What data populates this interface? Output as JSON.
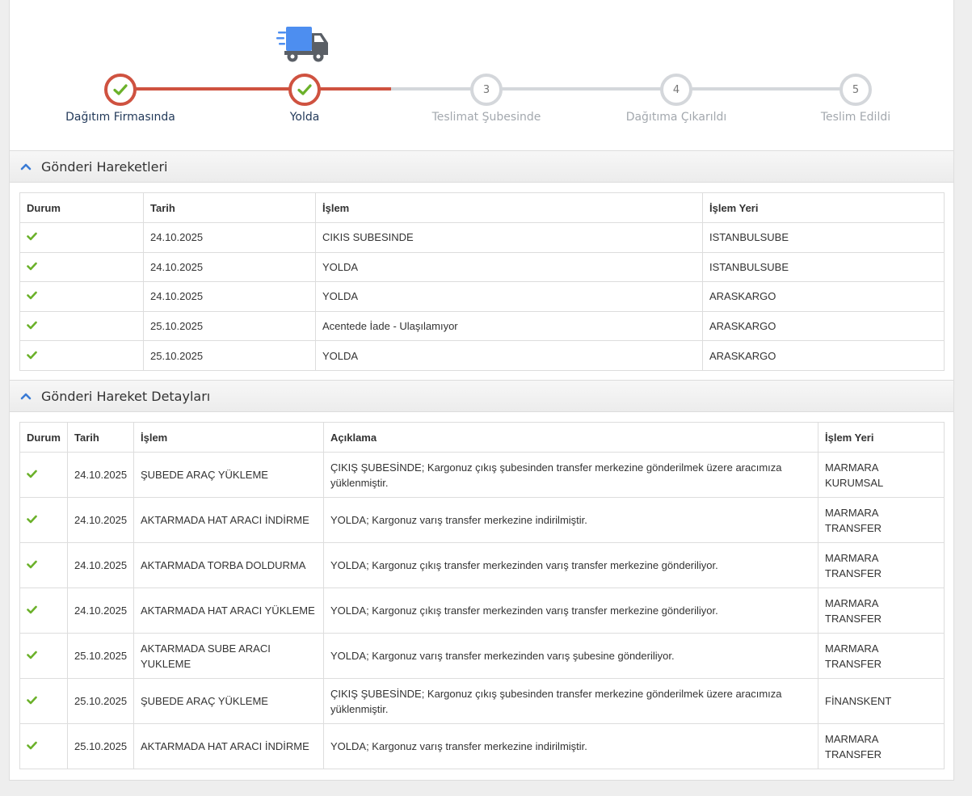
{
  "tracker": {
    "truck_icon": "truck-icon",
    "steps": [
      {
        "number": "1",
        "label": "Dağıtım Firmasında",
        "status": "done"
      },
      {
        "number": "2",
        "label": "Yolda",
        "status": "done"
      },
      {
        "number": "3",
        "label": "Teslimat Şubesinde",
        "status": "pending"
      },
      {
        "number": "4",
        "label": "Dağıtıma Çıkarıldı",
        "status": "pending"
      },
      {
        "number": "5",
        "label": "Teslim Edildi",
        "status": "pending"
      }
    ],
    "colors": {
      "done": "#cf5240",
      "pending": "#d4d7db",
      "check": "#6bb12a"
    }
  },
  "movements": {
    "title": "Gönderi Hareketleri",
    "headers": [
      "Durum",
      "Tarih",
      "İşlem",
      "İşlem Yeri"
    ],
    "rows": [
      {
        "status_icon": "check-icon",
        "date": "24.10.2025",
        "action": "CIKIS SUBESINDE",
        "place": "ISTANBULSUBE"
      },
      {
        "status_icon": "check-icon",
        "date": "24.10.2025",
        "action": "YOLDA",
        "place": "ISTANBULSUBE"
      },
      {
        "status_icon": "check-icon",
        "date": "24.10.2025",
        "action": "YOLDA",
        "place": "ARASKARGO"
      },
      {
        "status_icon": "check-icon",
        "date": "25.10.2025",
        "action": "Acentede İade - Ulaşılamıyor",
        "place": "ARASKARGO"
      },
      {
        "status_icon": "check-icon",
        "date": "25.10.2025",
        "action": "YOLDA",
        "place": "ARASKARGO"
      }
    ]
  },
  "details": {
    "title": "Gönderi Hareket Detayları",
    "headers": [
      "Durum",
      "Tarih",
      "İşlem",
      "Açıklama",
      "İşlem Yeri"
    ],
    "rows": [
      {
        "status_icon": "check-icon",
        "date": "24.10.2025",
        "action": "ŞUBEDE ARAÇ YÜKLEME",
        "description": "ÇIKIŞ ŞUBESİNDE; Kargonuz çıkış şubesinden transfer merkezine gönderilmek üzere aracımıza yüklenmiştir.",
        "place": "MARMARA KURUMSAL"
      },
      {
        "status_icon": "check-icon",
        "date": "24.10.2025",
        "action": "AKTARMADA HAT ARACI İNDİRME",
        "description": "YOLDA; Kargonuz varış transfer merkezine indirilmiştir.",
        "place": "MARMARA TRANSFER"
      },
      {
        "status_icon": "check-icon",
        "date": "24.10.2025",
        "action": "AKTARMADA TORBA DOLDURMA",
        "description": "YOLDA; Kargonuz çıkış transfer merkezinden varış transfer merkezine gönderiliyor.",
        "place": "MARMARA TRANSFER"
      },
      {
        "status_icon": "check-icon",
        "date": "24.10.2025",
        "action": "AKTARMADA HAT ARACI YÜKLEME",
        "description": "YOLDA; Kargonuz çıkış transfer merkezinden varış transfer merkezine gönderiliyor.",
        "place": "MARMARA TRANSFER"
      },
      {
        "status_icon": "check-icon",
        "date": "25.10.2025",
        "action": "AKTARMADA SUBE ARACI YUKLEME",
        "description": "YOLDA; Kargonuz varış transfer merkezinden varış şubesine gönderiliyor.",
        "place": "MARMARA TRANSFER"
      },
      {
        "status_icon": "check-icon",
        "date": "25.10.2025",
        "action": "ŞUBEDE ARAÇ YÜKLEME",
        "description": "ÇIKIŞ ŞUBESİNDE; Kargonuz çıkış şubesinden transfer merkezine gönderilmek üzere aracımıza yüklenmiştir.",
        "place": "FİNANSKENT"
      },
      {
        "status_icon": "check-icon",
        "date": "25.10.2025",
        "action": "AKTARMADA HAT ARACI İNDİRME",
        "description": "YOLDA; Kargonuz varış transfer merkezine indirilmiştir.",
        "place": "MARMARA TRANSFER"
      }
    ]
  }
}
